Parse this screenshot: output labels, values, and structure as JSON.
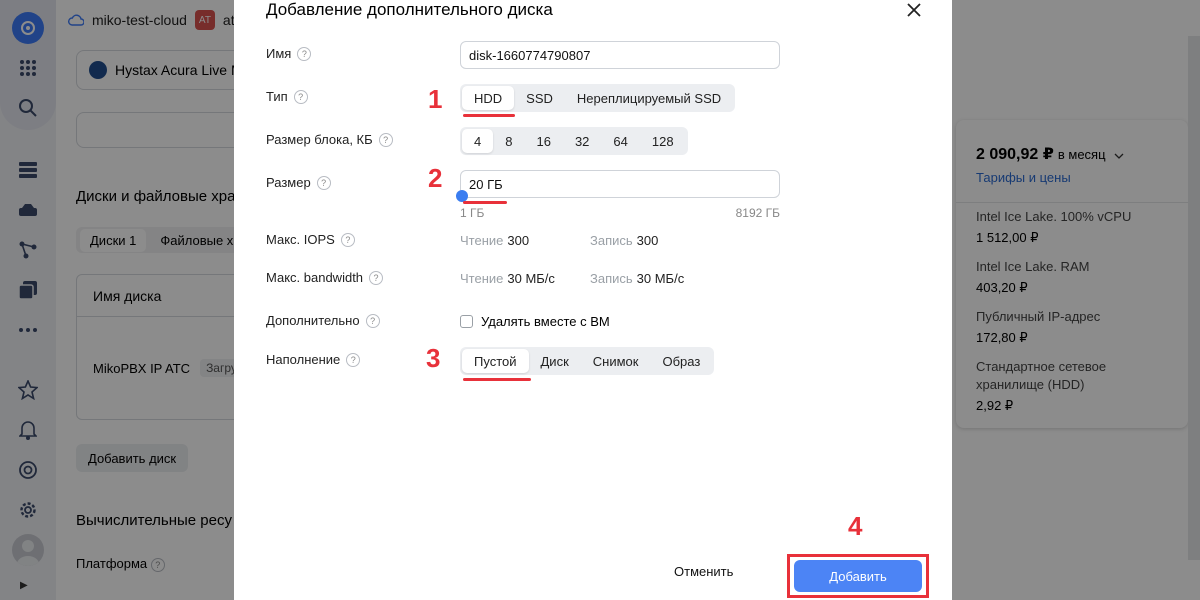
{
  "background": {
    "cloud_name": "miko-test-cloud",
    "folder_badge": "AT",
    "folder_name": "ata",
    "vm_card": "Hystax Acura Live M",
    "disks_section_title": "Диски и файловые хра",
    "tab_disks": "Диски 1",
    "tab_filestores": "Файловые х",
    "table_header_name": "Имя диска",
    "disk_row_name": "MikoPBX IP ATC",
    "disk_row_chip": "Загру",
    "add_disk_button": "Добавить диск",
    "compute_section_title": "Вычислительные ресу",
    "platform_label": "Платформа"
  },
  "price": {
    "total": "2 090,92 ₽",
    "period": "в месяц",
    "tariffs_link": "Тарифы и цены",
    "items": [
      {
        "name": "Intel Ice Lake. 100% vCPU",
        "value": "1 512,00 ₽"
      },
      {
        "name": "Intel Ice Lake. RAM",
        "value": "403,20 ₽"
      },
      {
        "name": "Публичный IP-адрес",
        "value": "172,80 ₽"
      },
      {
        "name": "Стандартное сетевое хранилище (HDD)",
        "value": "2,92 ₽"
      }
    ]
  },
  "modal": {
    "title": "Добавление дополнительного диска",
    "labels": {
      "name": "Имя",
      "type": "Тип",
      "block_size": "Размер блока, КБ",
      "size": "Размер",
      "max_iops": "Макс. IOPS",
      "max_bandwidth": "Макс. bandwidth",
      "additional": "Дополнительно",
      "filling": "Наполнение"
    },
    "name_value": "disk-1660774790807",
    "type_options": [
      "HDD",
      "SSD",
      "Нереплицируемый SSD"
    ],
    "block_options": [
      "4",
      "8",
      "16",
      "32",
      "64",
      "128"
    ],
    "size_value": "20 ГБ",
    "size_min": "1 ГБ",
    "size_max": "8192 ГБ",
    "iops": {
      "read_label": "Чтение",
      "read": "300",
      "write_label": "Запись",
      "write": "300"
    },
    "bandwidth": {
      "read_label": "Чтение",
      "read": "30 МБ/с",
      "write_label": "Запись",
      "write": "30 МБ/с"
    },
    "delete_with_vm": "Удалять вместе с ВМ",
    "filling_options": [
      "Пустой",
      "Диск",
      "Снимок",
      "Образ"
    ],
    "cancel": "Отменить",
    "submit": "Добавить"
  },
  "annotations": [
    "1",
    "2",
    "3",
    "4"
  ],
  "help_glyph": "?"
}
